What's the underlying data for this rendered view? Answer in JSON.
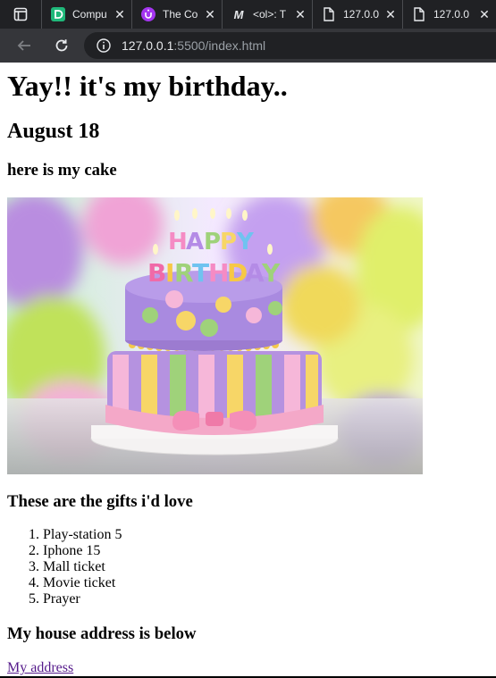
{
  "browser": {
    "tabs": [
      {
        "title": "Compu",
        "icon": "codedamn-icon"
      },
      {
        "title": "The Co",
        "icon": "udemy-icon"
      },
      {
        "title": "<ol>: T",
        "icon": "mdn-icon"
      },
      {
        "title": "127.0.0",
        "icon": "file-icon"
      },
      {
        "title": "127.0.0",
        "icon": "file-icon"
      }
    ],
    "url_host": "127.0.0.1",
    "url_path": ":5500/index.html"
  },
  "page": {
    "heading": "Yay!! it's my birthday..",
    "date": "August 18",
    "cake_caption": "here is my cake",
    "cake_image": {
      "letters": "HAPPY BIRTHDAY"
    },
    "gifts_heading": "These are the gifts i'd love",
    "gifts": [
      "Play-station 5",
      "Iphone 15",
      "Mall ticket",
      "Movie ticket",
      "Prayer"
    ],
    "address_heading": "My house address is below",
    "address_link": "My address"
  }
}
